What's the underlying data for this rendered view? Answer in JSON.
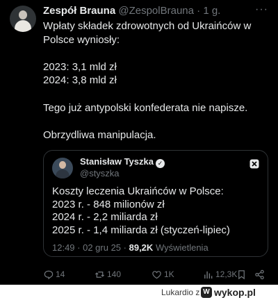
{
  "post": {
    "author_name": "Zespół Brauna",
    "author_handle": "@ZespolBrauna",
    "separator": "·",
    "time": "1 g.",
    "more_icon": "more-dots-icon",
    "lines": [
      "Wpłaty składek zdrowotnych od Ukraińców w Polsce wyniosły:",
      "",
      "2023: 3,1 mld zł",
      "2024: 3,8 mld zł",
      "",
      "Tego już antypolski konfederata nie napisze.",
      "",
      "Obrzydliwa manipulacja."
    ]
  },
  "quote": {
    "author_name": "Stanisław Tyszka",
    "author_handle": "@styszka",
    "lines": [
      "Koszty leczenia Ukraińców w Polsce:",
      "2023 r. - 848 milionów zł",
      "2024 r. - 2,2 miliarda zł",
      "2025 r. - 1,4 miliarda zł (styczeń-lipiec)"
    ],
    "time": "12:49",
    "date": "02 gru 25",
    "views": "89,2K",
    "views_label": "Wyświetlenia"
  },
  "actions": {
    "replies": "14",
    "reposts": "140",
    "likes": "1K",
    "views": "12,3K"
  },
  "footer": {
    "user": "Lukardio",
    "site_prefix": "z",
    "site": "wykop.pl"
  },
  "colors": {
    "background": "#000000",
    "text": "#e7e9ea",
    "muted": "#71767b",
    "border": "#2f3336"
  }
}
